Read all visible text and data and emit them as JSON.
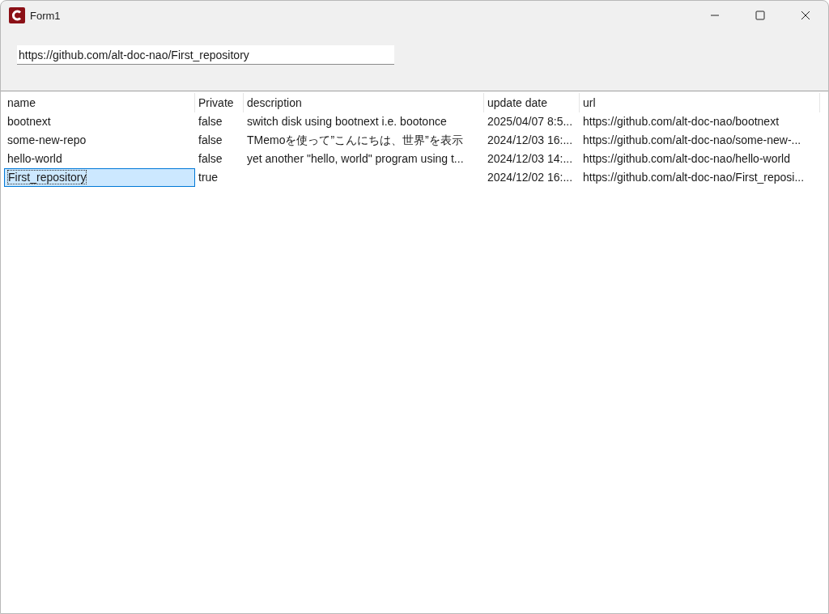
{
  "window": {
    "title": "Form1"
  },
  "url_field": {
    "value": "https://github.com/alt-doc-nao/First_repository"
  },
  "table": {
    "columns": [
      "name",
      "Private",
      "description",
      "update date",
      "url"
    ],
    "rows": [
      {
        "selected": false,
        "cells": [
          "bootnext",
          "false",
          "switch disk using bootnext i.e. bootonce",
          "2025/04/07 8:5...",
          "https://github.com/alt-doc-nao/bootnext"
        ]
      },
      {
        "selected": false,
        "cells": [
          "some-new-repo",
          "false",
          "TMemoを使って”こんにちは、世界”を表示",
          "2024/12/03 16:...",
          "https://github.com/alt-doc-nao/some-new-..."
        ]
      },
      {
        "selected": false,
        "cells": [
          "hello-world",
          "false",
          "yet another \"hello, world\" program using t...",
          "2024/12/03 14:...",
          "https://github.com/alt-doc-nao/hello-world"
        ]
      },
      {
        "selected": true,
        "cells": [
          "First_repository",
          "true",
          "",
          "2024/12/02 16:...",
          "https://github.com/alt-doc-nao/First_reposi..."
        ]
      }
    ]
  }
}
